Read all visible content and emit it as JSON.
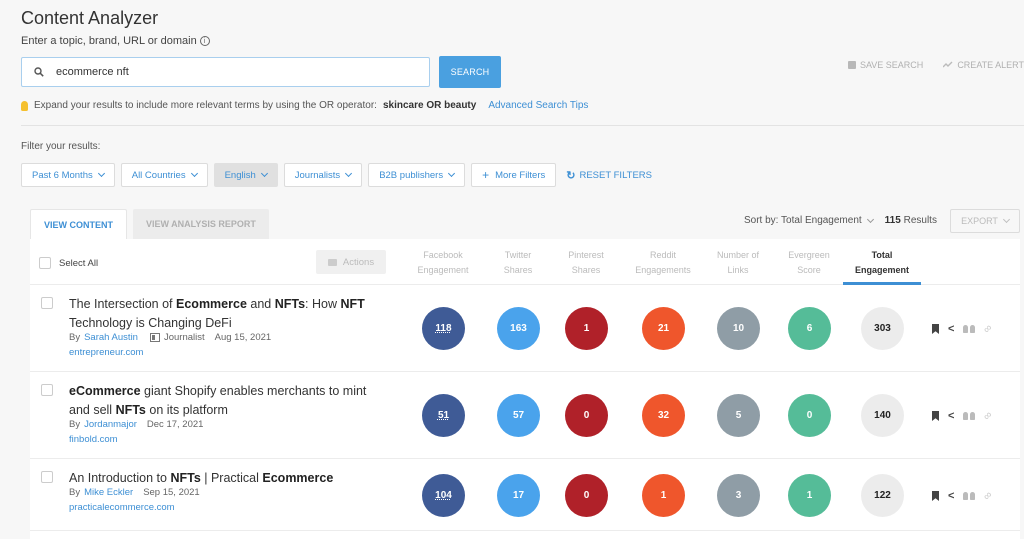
{
  "header": {
    "title": "Content Analyzer",
    "subtitle": "Enter a topic, brand, URL or domain",
    "info_glyph": "i"
  },
  "search": {
    "value": "ecommerce nft",
    "button_label": "SEARCH"
  },
  "top_actions": {
    "save_search": "SAVE SEARCH",
    "create_alert": "CREATE ALERT"
  },
  "tip": {
    "text": "Expand your results to include more relevant terms by using the OR operator:",
    "example": "skincare OR beauty",
    "link": "Advanced Search Tips"
  },
  "filters": {
    "label": "Filter your results:",
    "items": [
      {
        "label": "Past 6 Months",
        "disabled": false
      },
      {
        "label": "All Countries",
        "disabled": false
      },
      {
        "label": "English",
        "disabled": true
      },
      {
        "label": "Journalists",
        "disabled": false
      },
      {
        "label": "B2B publishers",
        "disabled": false
      }
    ],
    "more_filters": "More Filters",
    "reset": "RESET FILTERS"
  },
  "tabs": [
    {
      "label": "VIEW CONTENT",
      "active": true
    },
    {
      "label": "VIEW ANALYSIS REPORT",
      "active": false
    }
  ],
  "sort": {
    "label": "Sort by: Total Engagement",
    "results_count": "115",
    "results_label": "Results",
    "export_label": "EXPORT"
  },
  "table": {
    "select_all": "Select All",
    "actions_label": "Actions",
    "columns": [
      {
        "line1": "Facebook",
        "line2": "Engagement",
        "color": "#3f5b96"
      },
      {
        "line1": "Twitter",
        "line2": "Shares",
        "color": "#4aa3ec"
      },
      {
        "line1": "Pinterest",
        "line2": "Shares",
        "color": "#b02129"
      },
      {
        "line1": "Reddit",
        "line2": "Engagements",
        "color": "#ef562c"
      },
      {
        "line1": "Number of",
        "line2": "Links",
        "color": "#8f9da6"
      },
      {
        "line1": "Evergreen",
        "line2": "Score",
        "color": "#55bc98"
      },
      {
        "line1": "Total",
        "line2": "Engagement",
        "color": "#ececec",
        "active": true
      }
    ],
    "rows": [
      {
        "title_parts": [
          {
            "t": "The Intersection of ",
            "b": false
          },
          {
            "t": "Ecommerce",
            "b": true
          },
          {
            "t": " and ",
            "b": false
          },
          {
            "t": "NFTs",
            "b": true
          },
          {
            "t": ": How ",
            "b": false
          },
          {
            "t": "NFT",
            "b": true
          },
          {
            "t": " Technology is Changing DeFi",
            "b": false
          }
        ],
        "by": "By",
        "author": "Sarah Austin",
        "role": "Journalist",
        "date": "Aug 15, 2021",
        "domain": "entrepreneur.com",
        "values": [
          "118",
          "163",
          "1",
          "21",
          "10",
          "6",
          "303"
        ]
      },
      {
        "title_parts": [
          {
            "t": "eCommerce",
            "b": true
          },
          {
            "t": " giant Shopify enables merchants to mint and sell ",
            "b": false
          },
          {
            "t": "NFTs",
            "b": true
          },
          {
            "t": " on its platform",
            "b": false
          }
        ],
        "by": "By",
        "author": "Jordanmajor",
        "role": "",
        "date": "Dec 17, 2021",
        "domain": "finbold.com",
        "values": [
          "51",
          "57",
          "0",
          "32",
          "5",
          "0",
          "140"
        ]
      },
      {
        "title_parts": [
          {
            "t": "An Introduction to ",
            "b": false
          },
          {
            "t": "NFTs",
            "b": true
          },
          {
            "t": " | Practical ",
            "b": false
          },
          {
            "t": "Ecommerce",
            "b": true
          }
        ],
        "by": "By",
        "author": "Mike Eckler",
        "role": "",
        "date": "Sep 15, 2021",
        "domain": "practicalecommerce.com",
        "values": [
          "104",
          "17",
          "0",
          "1",
          "3",
          "1",
          "122"
        ]
      }
    ]
  }
}
